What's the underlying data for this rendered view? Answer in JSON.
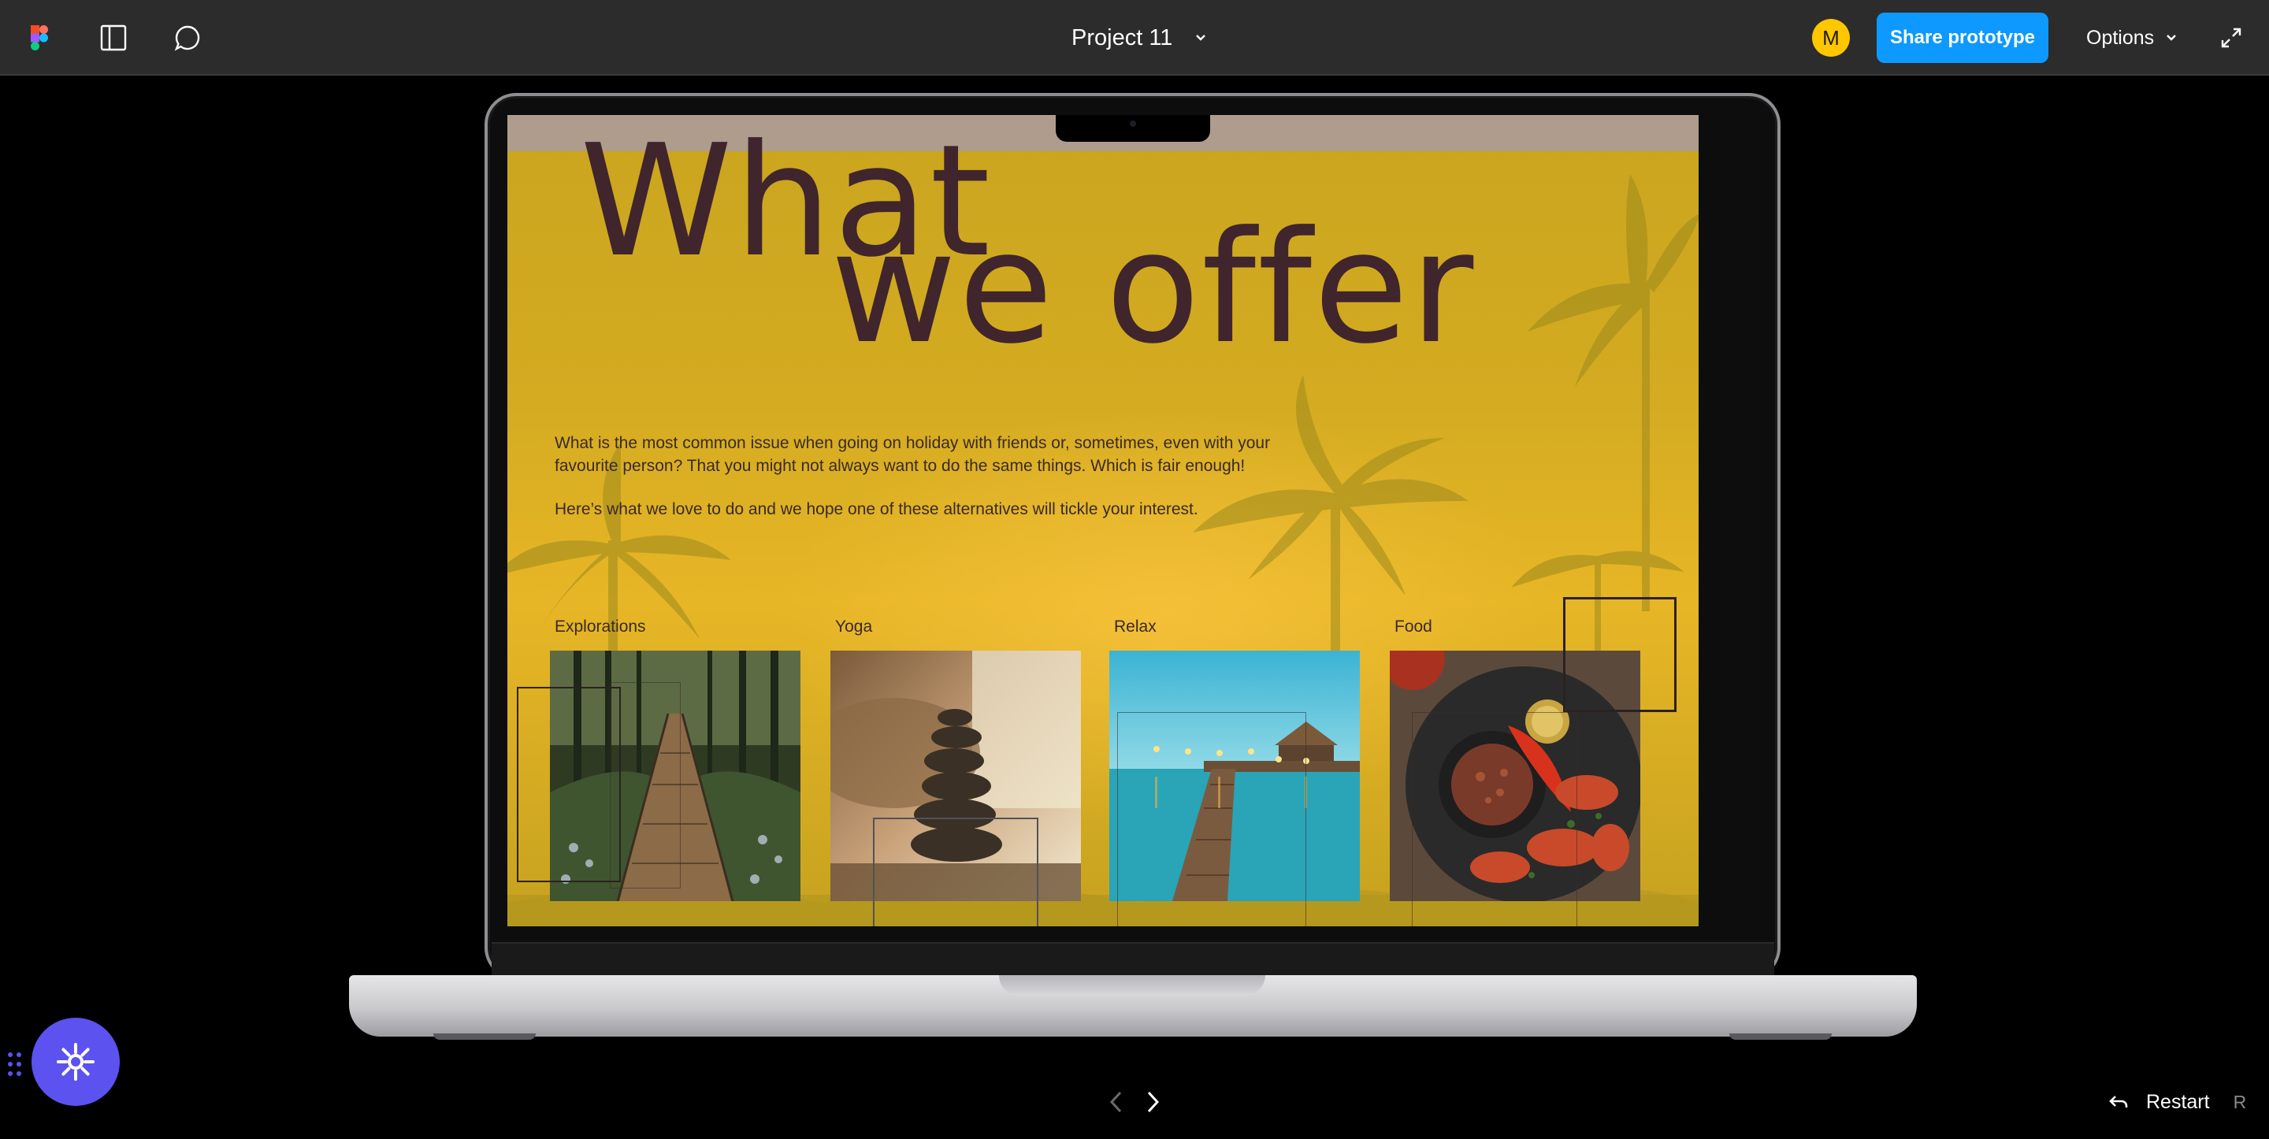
{
  "toolbar": {
    "project_title": "Project 11",
    "avatar_initial": "M",
    "share_label": "Share prototype",
    "options_label": "Options"
  },
  "slide": {
    "headline_line1": "What",
    "headline_line2": "we offer",
    "paragraph1": "What is the most common issue when going on holiday with friends or, sometimes, even with your favourite person? That you might not always want to do the same things. Which is fair enough!",
    "paragraph2": "Here’s what we love to do and we hope one of these alternatives will tickle your interest.",
    "categories": [
      {
        "label": "Explorations"
      },
      {
        "label": "Yoga"
      },
      {
        "label": "Relax"
      },
      {
        "label": "Food"
      }
    ]
  },
  "footer": {
    "restart_label": "Restart",
    "restart_key": "R"
  },
  "icons": [
    "figma-logo-icon",
    "sidebar-panel-icon",
    "comment-icon",
    "chevron-down-icon",
    "expand-icon",
    "plugin-icon",
    "drag-handle-icon",
    "chevron-left-icon",
    "chevron-right-icon",
    "restart-arrow-icon"
  ],
  "colors": {
    "toolbar_bg": "#2c2c2c",
    "share_button": "#0d99ff",
    "avatar": "#ffc700",
    "slide_bg": "#d4ab21",
    "headline": "#40252c",
    "plugin_button": "#5b52f0"
  }
}
